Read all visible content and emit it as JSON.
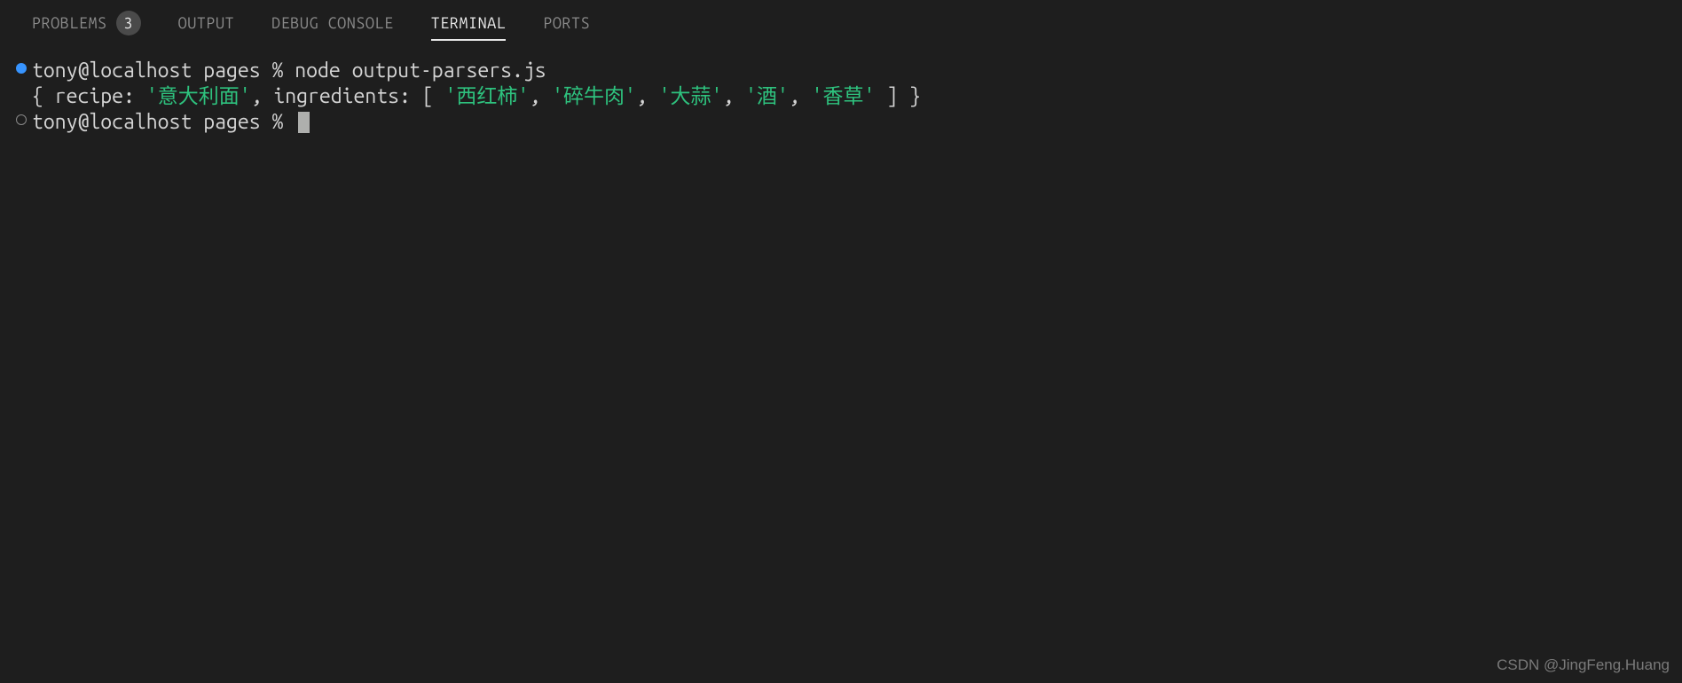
{
  "tabs": {
    "problems": {
      "label": "PROBLEMS",
      "badge": "3"
    },
    "output": {
      "label": "OUTPUT"
    },
    "debug_console": {
      "label": "DEBUG CONSOLE"
    },
    "terminal": {
      "label": "TERMINAL"
    },
    "ports": {
      "label": "PORTS"
    }
  },
  "terminal": {
    "line1": {
      "prompt": "tony@localhost pages % ",
      "command": "node output-parsers.js"
    },
    "line2": {
      "prefix": "{ recipe: ",
      "recipe_val": "'意大利面'",
      "sep1": ", ingredients: [ ",
      "ing1": "'西红柿'",
      "c1": ", ",
      "ing2": "'碎牛肉'",
      "c2": ", ",
      "ing3": "'大蒜'",
      "c3": ", ",
      "ing4": "'酒'",
      "c4": ", ",
      "ing5": "'香草'",
      "suffix": " ] }"
    },
    "line3": {
      "prompt": "tony@localhost pages % "
    }
  },
  "watermark": "CSDN @JingFeng.Huang"
}
